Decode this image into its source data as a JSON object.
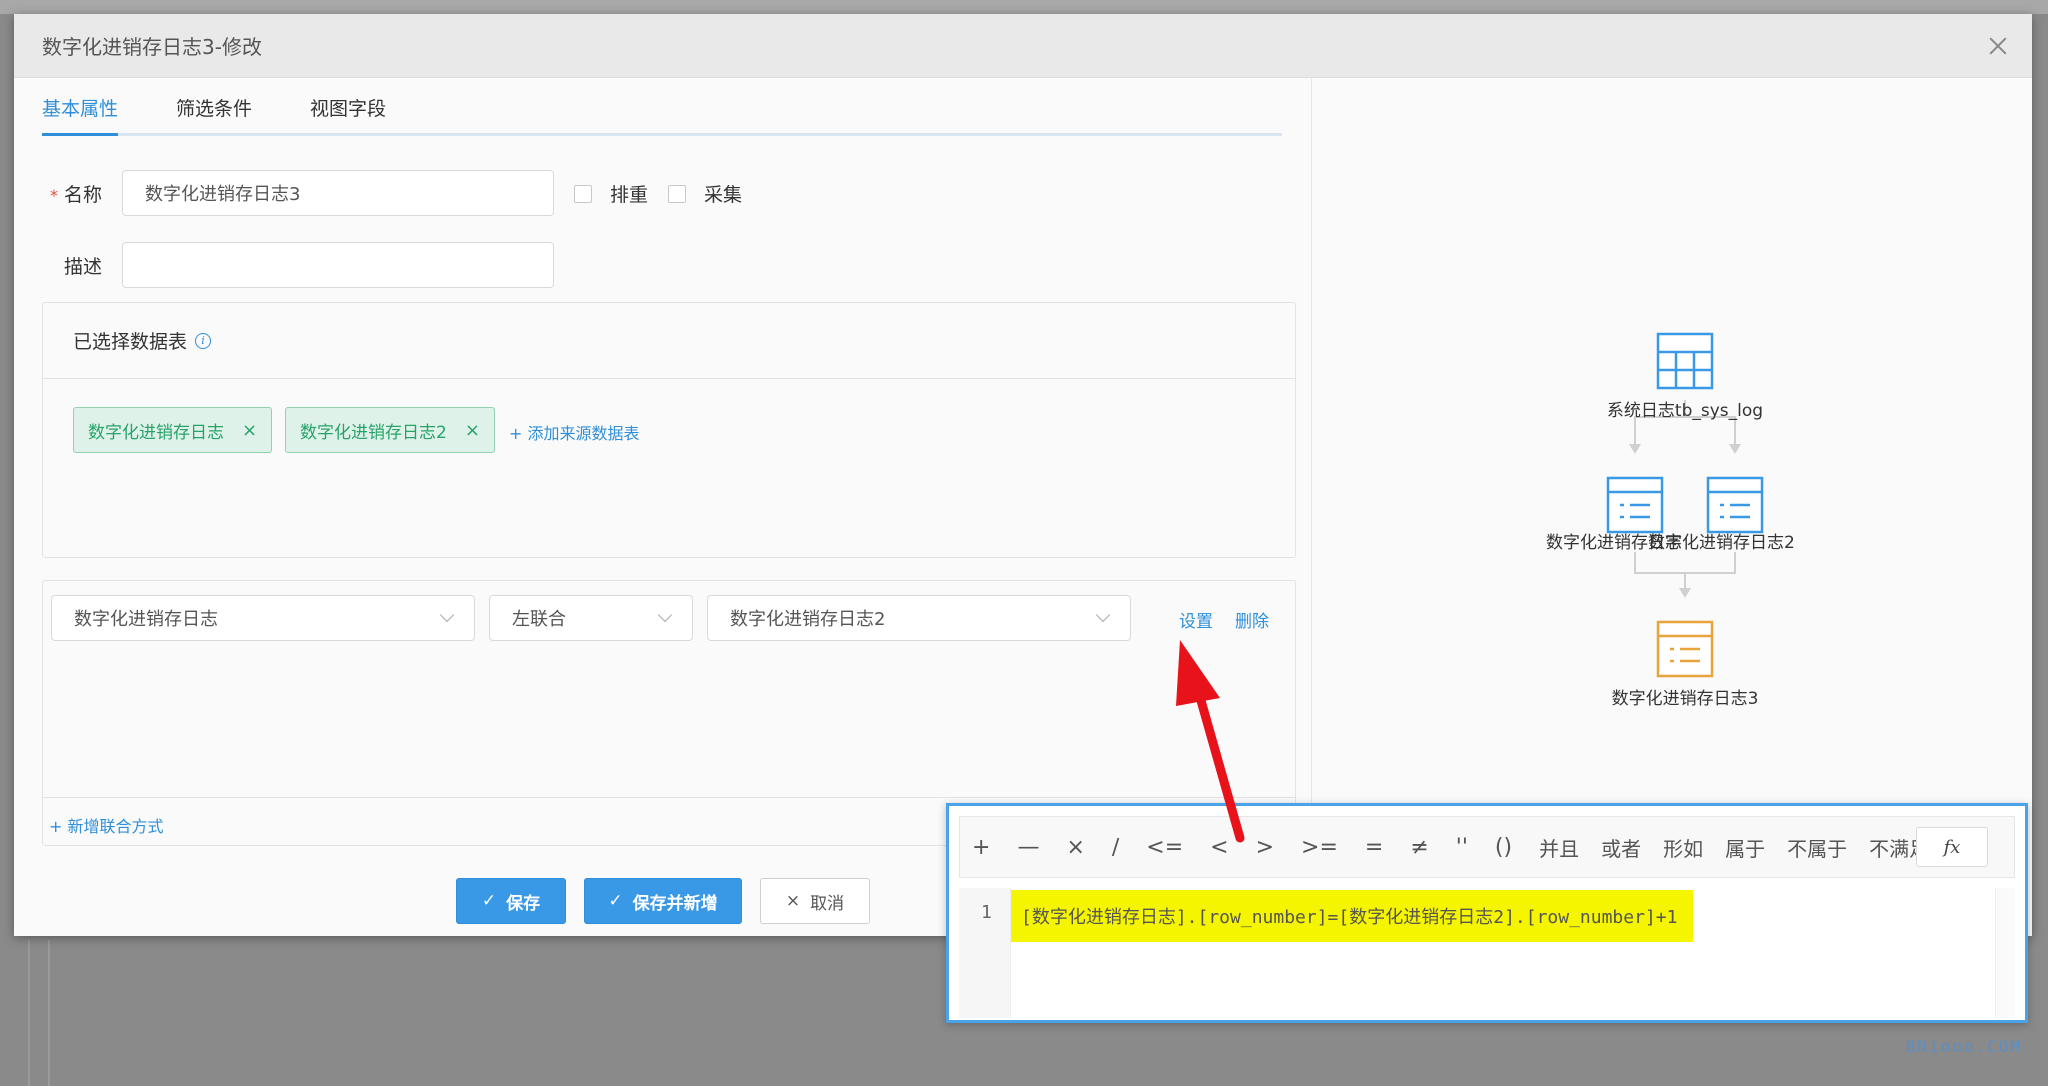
{
  "dialog": {
    "title": "数字化进销存日志3-修改"
  },
  "tabs": [
    {
      "label": "基本属性",
      "active": true
    },
    {
      "label": "筛选条件",
      "active": false
    },
    {
      "label": "视图字段",
      "active": false
    }
  ],
  "form": {
    "name_label": "名称",
    "required_mark": "*",
    "name_value": "数字化进销存日志3",
    "dedup_label": "排重",
    "collect_label": "采集",
    "desc_label": "描述",
    "desc_value": ""
  },
  "tables": {
    "header": "已选择数据表",
    "info_icon": "i",
    "tags": [
      {
        "label": "数字化进销存日志",
        "remove": "×"
      },
      {
        "label": "数字化进销存日志2",
        "remove": "×"
      }
    ],
    "add_label": "+ 添加来源数据表"
  },
  "join": {
    "left_table": "数字化进销存日志",
    "join_type": "左联合",
    "right_table": "数字化进销存日志2",
    "settings_label": "设置",
    "delete_label": "删除",
    "add_join_label": "+ 新增联合方式"
  },
  "buttons": {
    "save": "保存",
    "save_new": "保存并新增",
    "cancel": "取消",
    "check_glyph": "✓",
    "x_glyph": "×"
  },
  "diagram": {
    "root": "系统日志tb_sys_log",
    "child1": "数字化进销存日志",
    "child2": "数字化进销存日志2",
    "result": "数字化进销存日志3"
  },
  "formula": {
    "operators": [
      "+",
      "—",
      "×",
      "∕",
      "<=",
      "<",
      ">",
      ">=",
      "=",
      "≠",
      "''",
      "()"
    ],
    "word_ops": [
      "并且",
      "或者",
      "形如",
      "属于",
      "不属于",
      "不满足"
    ],
    "fx_label": "fx",
    "line_number": "1",
    "code": "[数字化进销存日志].[row_number]=[数字化进销存日志2].[row_number]+1"
  },
  "watermark": {
    "brand": "BNiooo.COM"
  },
  "colors": {
    "accent": "#2f8fd8",
    "tag_green": "#27a36a",
    "highlight": "#f5f500",
    "arrow_red": "#e8121a",
    "result_orange": "#e8a33b"
  }
}
